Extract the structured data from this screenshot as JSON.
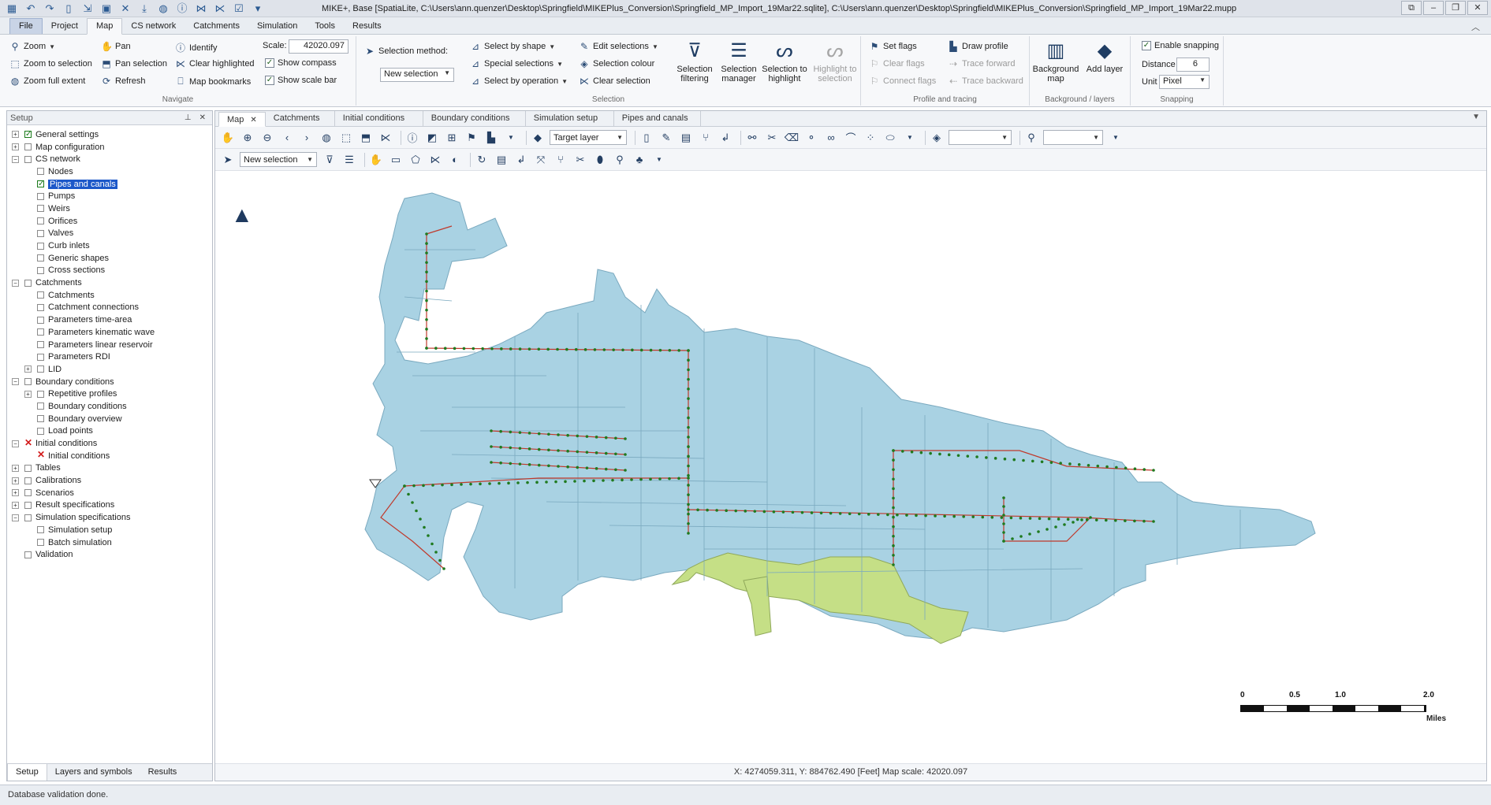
{
  "titlebar": {
    "title": "MIKE+, Base [SpatiaLite, C:\\Users\\ann.quenzer\\Desktop\\Springfield\\MIKEPlus_Conversion\\Springfield_MP_Import_19Mar22.sqlite], C:\\Users\\ann.quenzer\\Desktop\\Springfield\\MIKEPlus_Conversion\\Springfield_MP_Import_19Mar22.mupp"
  },
  "ribbon_tabs": [
    "File",
    "Project",
    "Map",
    "CS network",
    "Catchments",
    "Simulation",
    "Tools",
    "Results"
  ],
  "navigate": {
    "label": "Navigate",
    "zoom": "Zoom",
    "zoom_to_selection": "Zoom to selection",
    "zoom_full_extent": "Zoom full extent",
    "pan": "Pan",
    "pan_selection": "Pan selection",
    "refresh": "Refresh",
    "identify": "Identify",
    "clear_highlighted": "Clear highlighted",
    "map_bookmarks": "Map bookmarks",
    "scale_label": "Scale:",
    "scale_value": "42020.097",
    "show_compass": "Show compass",
    "show_scale_bar": "Show scale bar"
  },
  "selection": {
    "label": "Selection",
    "selection_method": "Selection method:",
    "selection_method_value": "New selection",
    "select_by_shape": "Select by shape",
    "special_selections": "Special selections",
    "select_by_operation": "Select by operation",
    "edit_selections": "Edit selections",
    "selection_colour": "Selection colour",
    "clear_selection": "Clear selection",
    "selection_filtering": "Selection filtering",
    "selection_manager": "Selection manager",
    "selection_to_highlight": "Selection to highlight",
    "highlight_to_selection": "Highlight to selection"
  },
  "profile": {
    "label": "Profile and tracing",
    "set_flags": "Set flags",
    "clear_flags": "Clear flags",
    "connect_flags": "Connect flags",
    "draw_profile": "Draw profile",
    "trace_forward": "Trace forward",
    "trace_backward": "Trace backward"
  },
  "background": {
    "label": "Background / layers",
    "background_map": "Background map",
    "add_layer": "Add layer"
  },
  "snapping": {
    "label": "Snapping",
    "enable_snapping": "Enable snapping",
    "distance_label": "Distance",
    "distance_value": "6",
    "unit_label": "Unit",
    "unit_value": "Pixel"
  },
  "setup_panel": {
    "title": "Setup",
    "tree": [
      {
        "label": "General settings",
        "level": 0,
        "exp": "+",
        "state": "checked"
      },
      {
        "label": "Map configuration",
        "level": 0,
        "exp": "+",
        "state": "empty"
      },
      {
        "label": "CS network",
        "level": 0,
        "exp": "-",
        "state": "empty"
      },
      {
        "label": "Nodes",
        "level": 1,
        "exp": "",
        "state": "empty"
      },
      {
        "label": "Pipes and canals",
        "level": 1,
        "exp": "",
        "state": "checked",
        "selected": true
      },
      {
        "label": "Pumps",
        "level": 1,
        "exp": "",
        "state": "empty"
      },
      {
        "label": "Weirs",
        "level": 1,
        "exp": "",
        "state": "empty"
      },
      {
        "label": "Orifices",
        "level": 1,
        "exp": "",
        "state": "empty"
      },
      {
        "label": "Valves",
        "level": 1,
        "exp": "",
        "state": "empty"
      },
      {
        "label": "Curb inlets",
        "level": 1,
        "exp": "",
        "state": "empty"
      },
      {
        "label": "Generic shapes",
        "level": 1,
        "exp": "",
        "state": "empty"
      },
      {
        "label": "Cross sections",
        "level": 1,
        "exp": "",
        "state": "empty"
      },
      {
        "label": "Catchments",
        "level": 0,
        "exp": "-",
        "state": "empty"
      },
      {
        "label": "Catchments",
        "level": 1,
        "exp": "",
        "state": "empty"
      },
      {
        "label": "Catchment connections",
        "level": 1,
        "exp": "",
        "state": "empty"
      },
      {
        "label": "Parameters time-area",
        "level": 1,
        "exp": "",
        "state": "empty"
      },
      {
        "label": "Parameters kinematic wave",
        "level": 1,
        "exp": "",
        "state": "empty"
      },
      {
        "label": "Parameters linear reservoir",
        "level": 1,
        "exp": "",
        "state": "empty"
      },
      {
        "label": "Parameters RDI",
        "level": 1,
        "exp": "",
        "state": "empty"
      },
      {
        "label": "LID",
        "level": 1,
        "exp": "+",
        "state": "empty"
      },
      {
        "label": "Boundary conditions",
        "level": 0,
        "exp": "-",
        "state": "empty"
      },
      {
        "label": "Repetitive profiles",
        "level": 1,
        "exp": "+",
        "state": "empty"
      },
      {
        "label": "Boundary conditions",
        "level": 1,
        "exp": "",
        "state": "empty"
      },
      {
        "label": "Boundary overview",
        "level": 1,
        "exp": "",
        "state": "empty"
      },
      {
        "label": "Load points",
        "level": 1,
        "exp": "",
        "state": "empty"
      },
      {
        "label": "Initial conditions",
        "level": 0,
        "exp": "-",
        "state": "error"
      },
      {
        "label": "Initial conditions",
        "level": 1,
        "exp": "",
        "state": "error"
      },
      {
        "label": "Tables",
        "level": 0,
        "exp": "+",
        "state": "empty"
      },
      {
        "label": "Calibrations",
        "level": 0,
        "exp": "+",
        "state": "empty"
      },
      {
        "label": "Scenarios",
        "level": 0,
        "exp": "+",
        "state": "empty"
      },
      {
        "label": "Result specifications",
        "level": 0,
        "exp": "+",
        "state": "empty"
      },
      {
        "label": "Simulation specifications",
        "level": 0,
        "exp": "-",
        "state": "empty"
      },
      {
        "label": "Simulation setup",
        "level": 1,
        "exp": "",
        "state": "empty"
      },
      {
        "label": "Batch simulation",
        "level": 1,
        "exp": "",
        "state": "empty"
      },
      {
        "label": "Validation",
        "level": 0,
        "exp": "",
        "state": "empty"
      }
    ],
    "bottom_tabs": [
      "Setup",
      "Layers and symbols",
      "Results"
    ]
  },
  "doc_tabs": [
    "Map",
    "Catchments",
    "Initial conditions",
    "Boundary conditions",
    "Simulation setup",
    "Pipes and canals"
  ],
  "map_toolbar": {
    "target_layer": "Target layer",
    "new_selection": "New selection"
  },
  "scale_bar": {
    "labels": [
      "0",
      "0.5",
      "1.0",
      "2.0"
    ],
    "unit": "Miles"
  },
  "map_status": "X: 4274059.311, Y: 884762.490 [Feet]    Map scale: 42020.097",
  "status_bar": "Database validation done.",
  "colors": {
    "catchment_fill": "#a9d2e3",
    "catchment_highlight": "#c5df86",
    "pipe": "#c0392b",
    "node": "#1f7a1f"
  }
}
